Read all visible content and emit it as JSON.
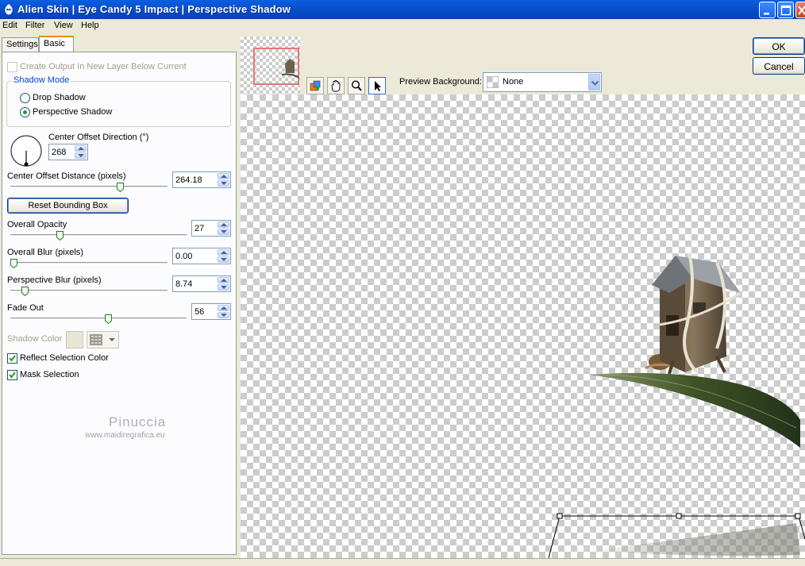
{
  "window": {
    "title": "Alien Skin  |  Eye Candy 5 Impact  |  Perspective Shadow"
  },
  "menu": {
    "items": [
      "Edit",
      "Filter",
      "View",
      "Help"
    ]
  },
  "tabs": {
    "settings": "Settings",
    "basic": "Basic"
  },
  "buttons": {
    "ok": "OK",
    "cancel": "Cancel",
    "reset_bbox": "Reset Bounding Box"
  },
  "panel": {
    "create_output_label": "Create Output In New Layer Below Current",
    "create_output_checked": false,
    "shadow_mode": {
      "title": "Shadow Mode",
      "options": [
        "Drop Shadow",
        "Perspective Shadow"
      ],
      "selected": "Perspective Shadow"
    },
    "center_offset_direction": {
      "label": "Center Offset Direction (°)",
      "value": "268"
    },
    "center_offset_distance": {
      "label": "Center Offset Distance (pixels)",
      "value": "264.18",
      "slider_fraction": 0.7
    },
    "overall_opacity": {
      "label": "Overall Opacity",
      "value": "27",
      "slider_fraction": 0.27
    },
    "overall_blur": {
      "label": "Overall Blur (pixels)",
      "value": "0.00",
      "slider_fraction": 0.0
    },
    "perspective_blur": {
      "label": "Perspective Blur (pixels)",
      "value": "8.74",
      "slider_fraction": 0.09
    },
    "fade_out": {
      "label": "Fade Out",
      "value": "56",
      "slider_fraction": 0.56
    },
    "shadow_color_label": "Shadow Color",
    "reflect_selection_color": {
      "label": "Reflect Selection Color",
      "checked": true
    },
    "mask_selection": {
      "label": "Mask Selection",
      "checked": true
    },
    "watermark": {
      "name": "Pinuccia",
      "url": "www.maidiregrafica.eu"
    }
  },
  "preview": {
    "background_label": "Preview Background:",
    "background_value": "None",
    "tools": [
      "color-picker-icon",
      "hand-icon",
      "zoom-icon",
      "arrow-pointer-icon"
    ],
    "selected_tool": "arrow-pointer-icon"
  }
}
